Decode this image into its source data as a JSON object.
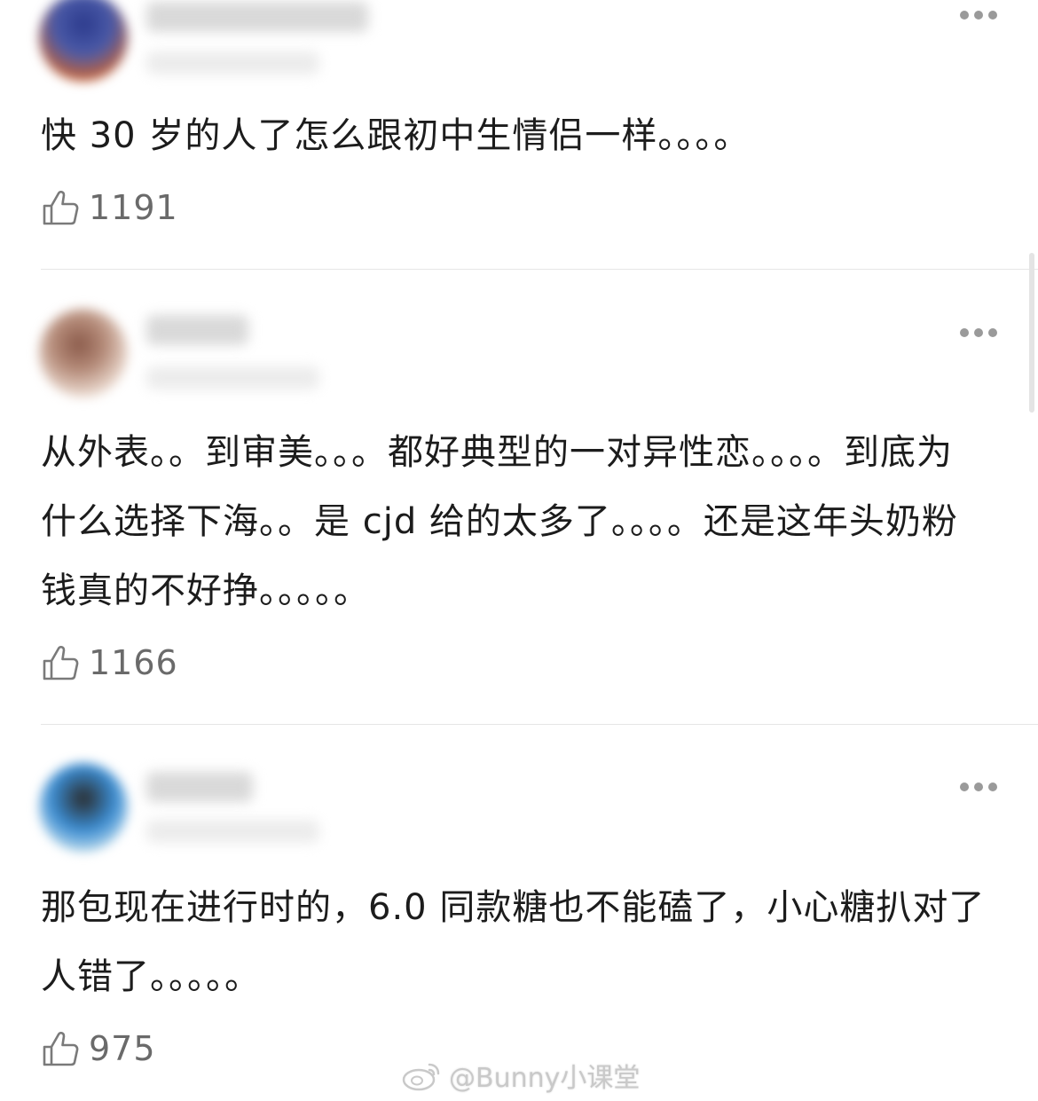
{
  "comments": [
    {
      "text": "快 30 岁的人了怎么跟初中生情侣一样。。。。",
      "likes": "1191",
      "avatar_colors": [
        "#2c3a8c",
        "#c0623c"
      ]
    },
    {
      "text": "从外表。。到审美。。。都好典型的一对异性恋。。。。到底为什么选择下海。。是 cjd 给的太多了。。。。还是这年头奶粉钱真的不好挣。。。。。",
      "likes": "1166",
      "avatar_colors": [
        "#8a5a4a",
        "#e9d7cc"
      ]
    },
    {
      "text": "那包现在进行时的，6.0 同款糖也不能磕了，小心糖扒对了人错了。。。。。",
      "likes": "975",
      "avatar_colors": [
        "#3a8bd0",
        "#2a2a2a"
      ]
    }
  ],
  "icons": {
    "like": "thumbs-up-icon",
    "more": "more-options-icon",
    "watermark": "weibo-logo-icon"
  },
  "watermark": {
    "text": "@Bunny小课堂"
  },
  "colors": {
    "text": "#1c1c1c",
    "muted": "#6a6a6a",
    "divider": "#e6e6e6",
    "dots": "#9a9a9a"
  }
}
